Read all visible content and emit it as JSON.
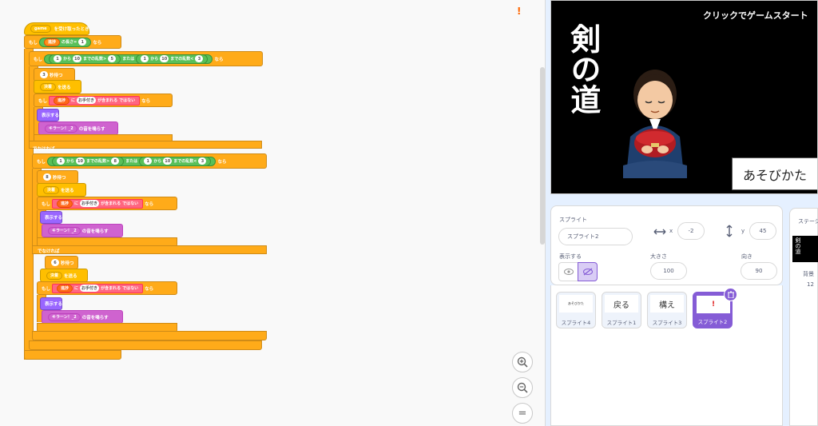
{
  "code": {
    "hat": {
      "var": "game",
      "text": "を受け取ったとき"
    },
    "if1": {
      "prefix": "もし",
      "var": "進捗",
      "op": "の長さ",
      "eq": "=",
      "val": "1",
      "suffix": "なら"
    },
    "if2": {
      "prefix": "もし",
      "a1": "1",
      "from": "から",
      "a2": "10",
      "rand": "までの乱数",
      "gt": ">",
      "a3": "5",
      "or": "または",
      "b1": "1",
      "b2": "10",
      "lt": "<",
      "b3": "3",
      "suffix": "なら"
    },
    "wait1": {
      "val": "3",
      "text": "秒待つ"
    },
    "send1": {
      "var": "決着",
      "text": "を送る"
    },
    "if3": {
      "prefix": "もし",
      "var": "進捗",
      "ni": "に",
      "val": "お手付き",
      "contains": "が含まれる",
      "not": "ではない",
      "suffix": "なら"
    },
    "show1": {
      "text": "表示する"
    },
    "sound1": {
      "var": "キラーン！_2",
      "text": "の音を鳴らす"
    },
    "else1": {
      "text": "でなければ"
    },
    "if4": {
      "prefix": "もし",
      "a1": "1",
      "from": "から",
      "a2": "10",
      "rand": "までの乱数",
      "gt": ">",
      "a3": "8",
      "or": "または",
      "b1": "1",
      "b2": "10",
      "lt": "<",
      "b3": "3",
      "suffix": "なら"
    },
    "wait2": {
      "val": "8",
      "text": "秒待つ"
    },
    "send2": {
      "var": "決着",
      "text": "を送る"
    },
    "if5": {
      "prefix": "もし",
      "var": "進捗",
      "ni": "に",
      "val": "お手付き",
      "contains": "が含まれる",
      "not": "ではない",
      "suffix": "なら"
    },
    "show2": {
      "text": "表示する"
    },
    "sound2": {
      "var": "キラーン！_2",
      "text": "の音を鳴らす"
    },
    "else2": {
      "text": "でなければ"
    },
    "wait3": {
      "val": "6",
      "text": "秒待つ"
    },
    "send3": {
      "var": "決着",
      "text": "を送る"
    },
    "if6": {
      "prefix": "もし",
      "var": "進捗",
      "ni": "に",
      "val": "お手付き",
      "contains": "が含まれる",
      "not": "ではない",
      "suffix": "なら"
    },
    "show3": {
      "text": "表示する"
    },
    "sound3": {
      "var": "キラーン！_2",
      "text": "の音を鳴らす"
    }
  },
  "zoom": {
    "in": "+",
    "out": "−",
    "reset": "="
  },
  "warning": "!",
  "stage": {
    "click_text": "クリックでゲームスタート",
    "title": "剣の道",
    "howto": "あそびかた"
  },
  "sprite_info": {
    "sprite_label": "スプライト",
    "sprite_name": "スプライト2",
    "x_label": "x",
    "x_value": "-2",
    "y_label": "y",
    "y_value": "45",
    "show_label": "表示する",
    "size_label": "大きさ",
    "size_value": "100",
    "direction_label": "向き",
    "direction_value": "90"
  },
  "sprites": [
    {
      "thumb": "あそびかた",
      "name": "スプライト4"
    },
    {
      "thumb": "戻る",
      "name": "スプライト1"
    },
    {
      "thumb": "構え",
      "name": "スプライト3"
    },
    {
      "thumb": "!",
      "name": "スプライト2"
    }
  ],
  "stage_pane": {
    "label": "ステージ",
    "backdrop_label": "背景",
    "backdrop_count": "12"
  },
  "colors": {
    "control": "#ffab19",
    "operator": "#59c059",
    "sound": "#cf63cf",
    "looks": "#9966ff",
    "selected": "#855cd6"
  }
}
